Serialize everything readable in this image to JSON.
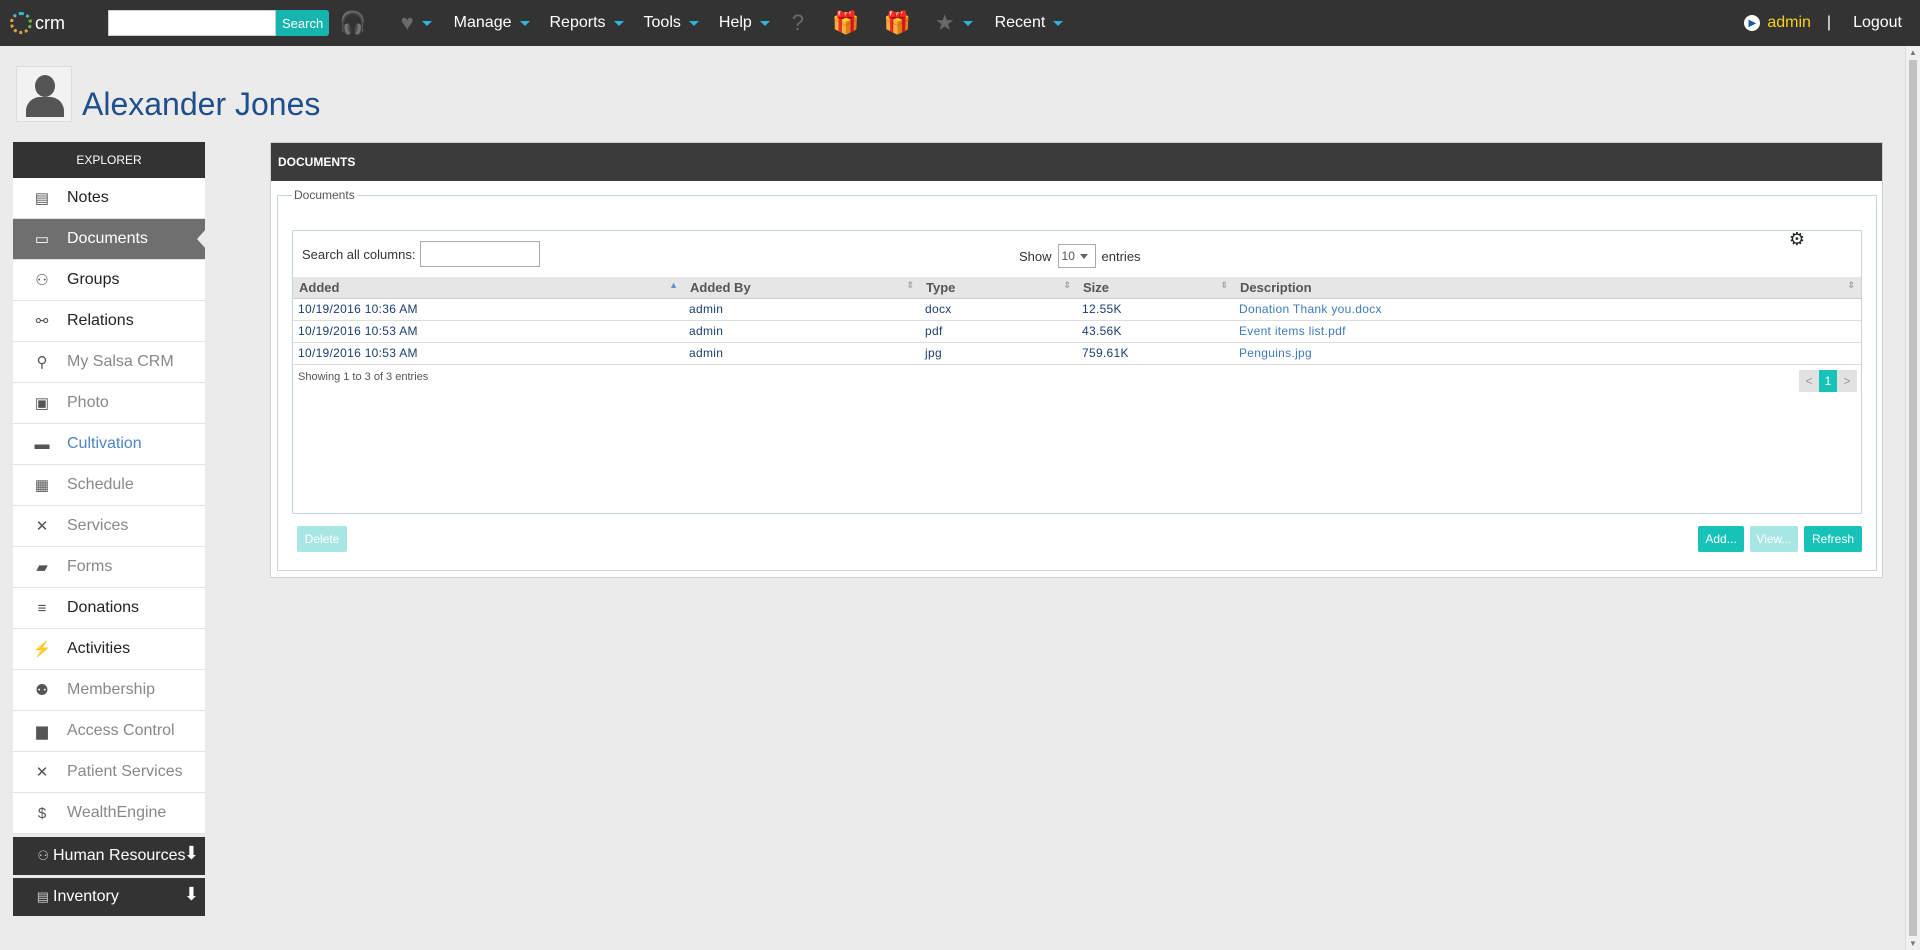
{
  "topbar": {
    "logo_text": "crm",
    "search_button": "Search",
    "menu": [
      "Manage",
      "Reports",
      "Tools",
      "Help",
      "Recent"
    ],
    "user": "admin",
    "separator": "|",
    "logout": "Logout"
  },
  "header": {
    "name": "Alexander Jones"
  },
  "sidebar": {
    "title": "EXPLORER",
    "items": [
      {
        "label": "Notes",
        "icon": "notes-icon",
        "glyph": "▤"
      },
      {
        "label": "Documents",
        "icon": "folder-icon",
        "glyph": "▭"
      },
      {
        "label": "Groups",
        "icon": "groups-icon",
        "glyph": "⚇"
      },
      {
        "label": "Relations",
        "icon": "link-icon",
        "glyph": "⚯"
      },
      {
        "label": "My Salsa CRM",
        "icon": "user-key-icon",
        "glyph": "⚲"
      },
      {
        "label": "Photo",
        "icon": "photo-icon",
        "glyph": "▣"
      },
      {
        "label": "Cultivation",
        "icon": "list-icon",
        "glyph": "▬"
      },
      {
        "label": "Schedule",
        "icon": "calendar-icon",
        "glyph": "▦"
      },
      {
        "label": "Services",
        "icon": "tools-icon",
        "glyph": "✕"
      },
      {
        "label": "Forms",
        "icon": "forms-icon",
        "glyph": "▰"
      },
      {
        "label": "Donations",
        "icon": "donations-icon",
        "glyph": "≡"
      },
      {
        "label": "Activities",
        "icon": "lightning-icon",
        "glyph": "⚡"
      },
      {
        "label": "Membership",
        "icon": "member-icon",
        "glyph": "⚉"
      },
      {
        "label": "Access Control",
        "icon": "lock-icon",
        "glyph": "▆"
      },
      {
        "label": "Patient Services",
        "icon": "tools-icon",
        "glyph": "✕"
      },
      {
        "label": "WealthEngine",
        "icon": "dollar-icon",
        "glyph": "$"
      }
    ],
    "groups": [
      {
        "label": "Human Resources",
        "icon": "hr-icon",
        "glyph": "⚇"
      },
      {
        "label": "Inventory",
        "icon": "inventory-icon",
        "glyph": "▤"
      }
    ]
  },
  "panel": {
    "title": "DOCUMENTS",
    "legend": "Documents",
    "search_label": "Search all columns:",
    "show_label": "Show",
    "show_value": "10",
    "entries_label": "entries",
    "columns": [
      "Added",
      "Added By",
      "Type",
      "Size",
      "Description"
    ],
    "rows": [
      [
        "10/19/2016 10:36 AM",
        "admin",
        "docx",
        "12.55K",
        "Donation Thank you.docx"
      ],
      [
        "10/19/2016 10:53 AM",
        "admin",
        "pdf",
        "43.56K",
        "Event items list.pdf"
      ],
      [
        "10/19/2016 10:53 AM",
        "admin",
        "jpg",
        "759.61K",
        "Penguins.jpg"
      ]
    ],
    "info": "Showing 1 to 3 of 3 entries",
    "pager": {
      "prev": "<",
      "current": "1",
      "next": ">"
    },
    "buttons": {
      "delete": "Delete",
      "add": "Add...",
      "view": "View...",
      "refresh": "Refresh"
    }
  },
  "colors": {
    "accent": "#17c3b8",
    "topbar": "#333333",
    "title": "#1f4e8c",
    "user": "#f7d417"
  }
}
